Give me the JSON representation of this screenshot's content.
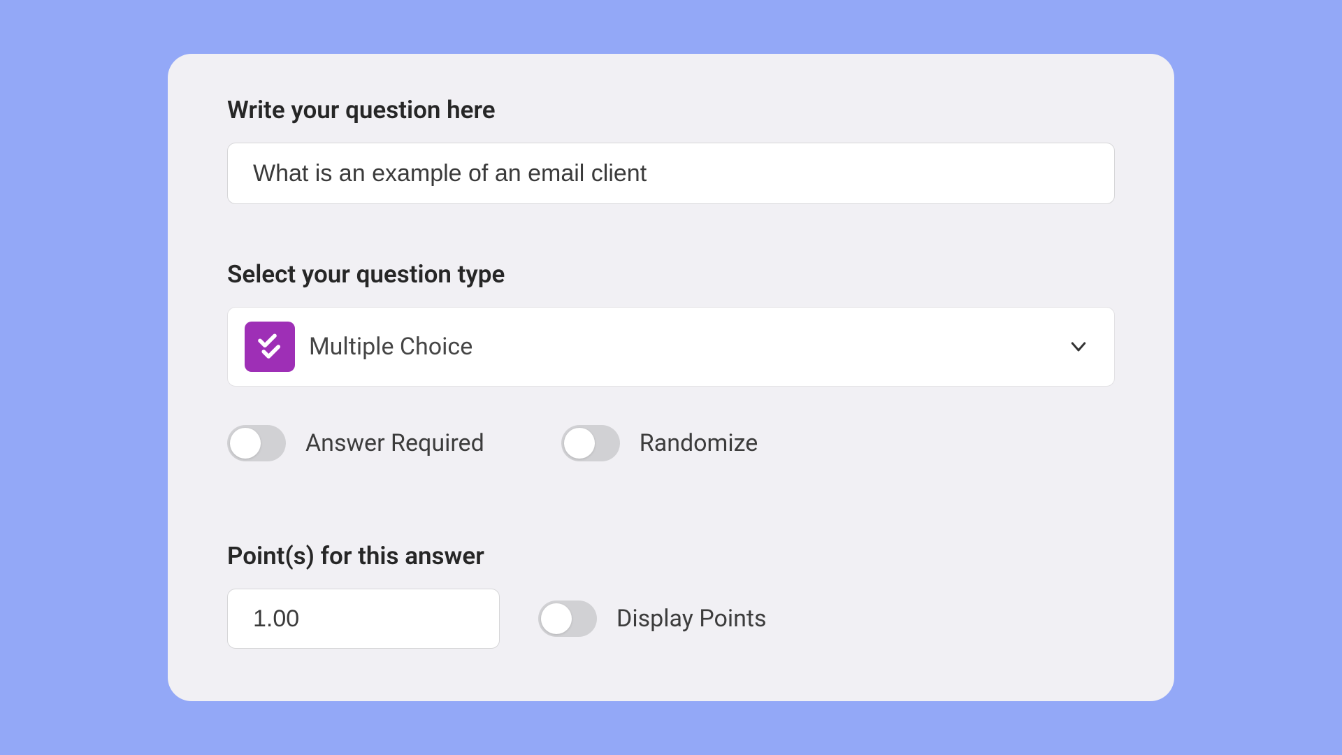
{
  "question": {
    "label": "Write your question here",
    "value": "What is an example of an email client"
  },
  "type": {
    "label": "Select your question type",
    "selected": "Multiple Choice"
  },
  "toggles": {
    "answer_required": {
      "label": "Answer Required",
      "on": false
    },
    "randomize": {
      "label": "Randomize",
      "on": false
    },
    "display_points": {
      "label": "Display Points",
      "on": false
    }
  },
  "points": {
    "label": "Point(s) for this answer",
    "value": "1.00"
  }
}
